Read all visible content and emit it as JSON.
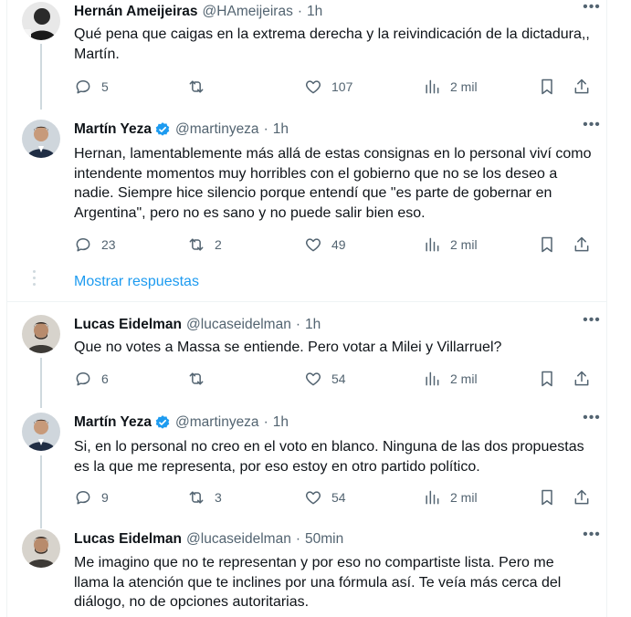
{
  "tweets": [
    {
      "name": "Hernán Ameijeiras",
      "handle": "@HAmeijeiras",
      "sep": "·",
      "time": "1h",
      "verified": false,
      "text": "Qué pena que caigas en la extrema derecha y la reivindicación de la dictadura,, Martín.",
      "replies": "5",
      "retweets": "",
      "likes": "107",
      "views": "2 mil"
    },
    {
      "name": "Martín Yeza",
      "handle": "@martinyeza",
      "sep": "·",
      "time": "1h",
      "verified": true,
      "text": "Hernan, lamentablemente más allá de estas consignas en lo personal viví como intendente momentos muy horribles con el gobierno que no se los deseo a nadie. Siempre hice silencio porque entendí que \"es parte de gobernar en Argentina\", pero no es sano y no puede salir bien eso.",
      "replies": "23",
      "retweets": "2",
      "likes": "49",
      "views": "2 mil"
    },
    {
      "name": "Lucas Eidelman",
      "handle": "@lucaseidelman",
      "sep": "·",
      "time": "1h",
      "verified": false,
      "text": "Que no votes a Massa se entiende. Pero votar a Milei y Villarruel?",
      "replies": "6",
      "retweets": "",
      "likes": "54",
      "views": "2 mil"
    },
    {
      "name": "Martín Yeza",
      "handle": "@martinyeza",
      "sep": "·",
      "time": "1h",
      "verified": true,
      "text": "Si, en lo personal no creo en el voto en blanco. Ninguna de las dos propuestas es la que me representa, por eso estoy en otro partido político.",
      "replies": "9",
      "retweets": "3",
      "likes": "54",
      "views": "2 mil"
    },
    {
      "name": "Lucas Eidelman",
      "handle": "@lucaseidelman",
      "sep": "·",
      "time": "50min",
      "verified": false,
      "text": "Me imagino que no te representan y por eso no compartiste lista. Pero me llama la atención que te inclines por una fórmula así. Te veía más cerca del diálogo, no de opciones autoritarias.",
      "replies": "",
      "retweets": "",
      "likes": "",
      "views": ""
    }
  ],
  "show_replies": "Mostrar respuestas",
  "colors": {
    "accent": "#1d9bf0",
    "secondary_text": "#536471",
    "verified_badge": "#1d9bf0"
  },
  "icons": [
    "reply-icon",
    "retweet-icon",
    "like-icon",
    "views-icon",
    "bookmark-icon",
    "share-icon",
    "more-icon",
    "verified-icon"
  ]
}
